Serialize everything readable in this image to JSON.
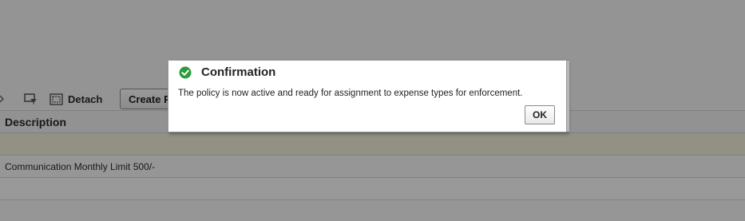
{
  "toolbar": {
    "detach_label": "Detach",
    "create_label": "Create P",
    "icons": [
      "unknown-icon",
      "filter-icon",
      "detach-icon"
    ]
  },
  "table": {
    "columns": [
      "Description"
    ],
    "rows": [
      {
        "description": ""
      },
      {
        "description": "Communication Monthly Limit 500/-"
      },
      {
        "description": ""
      }
    ]
  },
  "dialog": {
    "title": "Confirmation",
    "message": "The policy is now active and ready for assignment to expense types for enforcement.",
    "ok_label": "OK",
    "icon": "check-circle-icon",
    "icon_color": "#2a9d3a"
  },
  "colors": {
    "overlay": "#000000",
    "selected_row": "#f5f2da"
  }
}
